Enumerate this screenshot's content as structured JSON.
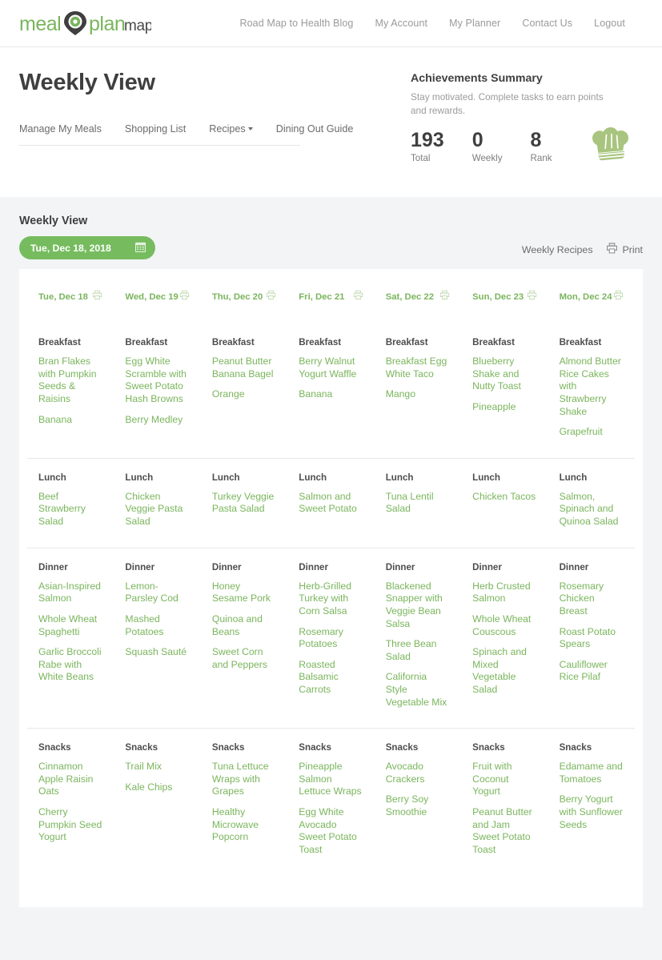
{
  "brand": {
    "text_meal": "meal",
    "text_plan": "plan",
    "text_map": "map",
    "logo_name": "meal-plan-map-logo",
    "green": "#7ab55c",
    "dark": "#3f3f3f"
  },
  "topnav": {
    "items": [
      {
        "label": "Road Map to Health Blog",
        "name": "nav-road-map-to-health-blog"
      },
      {
        "label": "My Account",
        "name": "nav-my-account"
      },
      {
        "label": "My Planner",
        "name": "nav-my-planner"
      },
      {
        "label": "Contact Us",
        "name": "nav-contact-us"
      },
      {
        "label": "Logout",
        "name": "nav-logout"
      }
    ]
  },
  "header": {
    "title": "Weekly View",
    "subnav": [
      {
        "label": "Manage My Meals",
        "name": "subnav-manage-my-meals",
        "caret": false
      },
      {
        "label": "Shopping List",
        "name": "subnav-shopping-list",
        "caret": false
      },
      {
        "label": "Recipes",
        "name": "subnav-recipes",
        "caret": true
      },
      {
        "label": "Dining Out Guide",
        "name": "subnav-dining-out-guide",
        "caret": false
      }
    ]
  },
  "achievements": {
    "title": "Achievements Summary",
    "subtitle": "Stay motivated. Complete tasks to earn points and rewards.",
    "stats": [
      {
        "value": "193",
        "label": "Total"
      },
      {
        "value": "0",
        "label": "Weekly"
      },
      {
        "value": "8",
        "label": "Rank"
      }
    ],
    "badge_icon": "chef-hat-icon"
  },
  "panel": {
    "title": "Weekly View",
    "date_value": "Tue, Dec 18, 2018",
    "calendar_icon": "calendar-icon",
    "weekly_recipes_label": "Weekly Recipes",
    "print_label": "Print",
    "print_icon": "printer-icon"
  },
  "days": [
    {
      "label": "Tue, Dec 18"
    },
    {
      "label": "Wed, Dec 19"
    },
    {
      "label": "Thu, Dec 20"
    },
    {
      "label": "Fri, Dec 21"
    },
    {
      "label": "Sat, Dec 22"
    },
    {
      "label": "Sun, Dec 23"
    },
    {
      "label": "Mon, Dec 24"
    }
  ],
  "meals": [
    {
      "label": "Breakfast",
      "cells": [
        [
          "Bran Flakes with Pumpkin Seeds & Raisins",
          "Banana"
        ],
        [
          "Egg White Scramble with Sweet Potato Hash Browns",
          "Berry Medley"
        ],
        [
          "Peanut Butter Banana Bagel",
          "Orange"
        ],
        [
          "Berry Walnut Yogurt Waffle",
          "Banana"
        ],
        [
          "Breakfast Egg White Taco",
          "Mango"
        ],
        [
          "Blueberry Shake and Nutty Toast",
          "Pineapple"
        ],
        [
          "Almond Butter Rice Cakes with Strawberry Shake",
          "Grapefruit"
        ]
      ]
    },
    {
      "label": "Lunch",
      "cells": [
        [
          "Beef Strawberry Salad"
        ],
        [
          "Chicken Veggie Pasta Salad"
        ],
        [
          "Turkey Veggie Pasta Salad"
        ],
        [
          "Salmon and Sweet Potato"
        ],
        [
          "Tuna Lentil Salad"
        ],
        [
          "Chicken Tacos"
        ],
        [
          "Salmon, Spinach and Quinoa Salad"
        ]
      ]
    },
    {
      "label": "Dinner",
      "cells": [
        [
          "Asian-Inspired Salmon",
          "Whole Wheat Spaghetti",
          "Garlic Broccoli Rabe with White Beans"
        ],
        [
          "Lemon-Parsley Cod",
          "Mashed Potatoes",
          "Squash Sauté"
        ],
        [
          "Honey Sesame Pork",
          "Quinoa and Beans",
          "Sweet Corn and Peppers"
        ],
        [
          "Herb-Grilled Turkey with Corn Salsa",
          "Rosemary Potatoes",
          "Roasted Balsamic Carrots"
        ],
        [
          "Blackened Snapper with Veggie Bean Salsa",
          "Three Bean Salad",
          "California Style Vegetable Mix"
        ],
        [
          "Herb Crusted Salmon",
          "Whole Wheat Couscous",
          "Spinach and Mixed Vegetable Salad"
        ],
        [
          "Rosemary Chicken Breast",
          "Roast Potato Spears",
          "Cauliflower Rice Pilaf"
        ]
      ]
    },
    {
      "label": "Snacks",
      "cells": [
        [
          "Cinnamon Apple Raisin Oats",
          "Cherry Pumpkin Seed Yogurt"
        ],
        [
          "Trail Mix",
          "Kale Chips"
        ],
        [
          "Tuna Lettuce Wraps with Grapes",
          "Healthy Microwave Popcorn"
        ],
        [
          "Pineapple Salmon Lettuce Wraps",
          "Egg White Avocado Sweet Potato Toast"
        ],
        [
          "Avocado Crackers",
          "Berry Soy Smoothie"
        ],
        [
          "Fruit with Coconut Yogurt",
          "Peanut Butter and Jam Sweet Potato Toast"
        ],
        [
          "Edamame and Tomatoes",
          "Berry Yogurt with Sunflower Seeds"
        ]
      ]
    }
  ]
}
